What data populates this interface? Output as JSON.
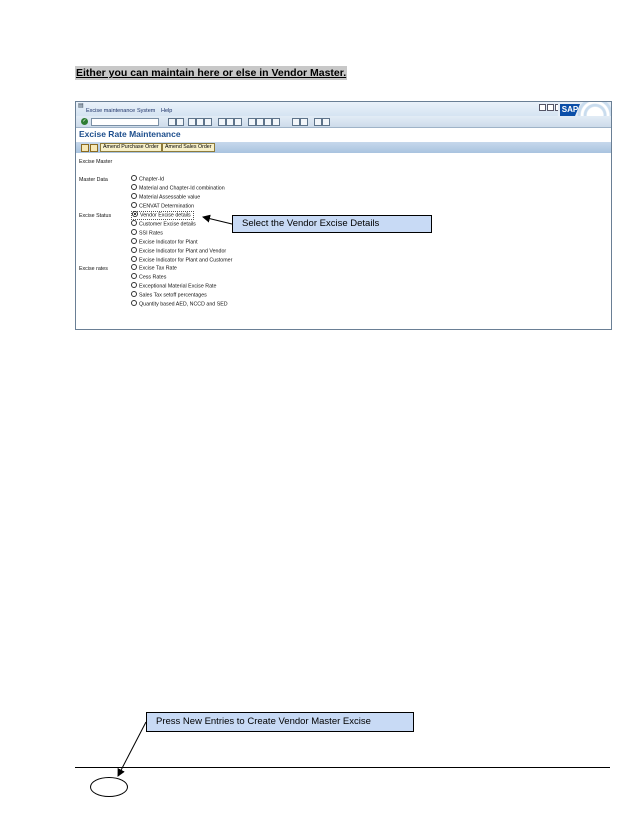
{
  "heading": "Either you can maintain here or else in Vendor Master.",
  "sap": {
    "menu": [
      "Excise maintenance",
      "System",
      "Help"
    ],
    "logo_text": "SAP",
    "title": "Excise Rate Maintenance",
    "app_buttons": [
      "Amend Purchase Order",
      "Amend Sales Order"
    ],
    "section_label": "Excise Master",
    "groups": [
      {
        "label": "Master Data",
        "options": [
          "Chapter-Id",
          "Material and Chapter-Id combination",
          "Material Assessable value",
          "CENVAT Determination"
        ]
      },
      {
        "label": "Excise Status",
        "options": [
          "Vendor Excise details",
          "Customer Excise details",
          "SSI Rates",
          "Excise Indicator for Plant",
          "Excise Indicator for Plant and Vendor",
          "Excise Indicator for Plant and Customer"
        ]
      },
      {
        "label": "Excise rates",
        "options": [
          "Excise Tax Rate",
          "Cess Rates",
          "Exceptional Material Excise Rate",
          "Sales Tax setoff percentages",
          "Quantity based AED, NCCD and SED"
        ]
      }
    ],
    "selected_option": "Vendor Excise details"
  },
  "callout_vendor": "Select the Vendor Excise Details",
  "callout_new_entries": "Press New Entries to Create Vendor Master Excise"
}
